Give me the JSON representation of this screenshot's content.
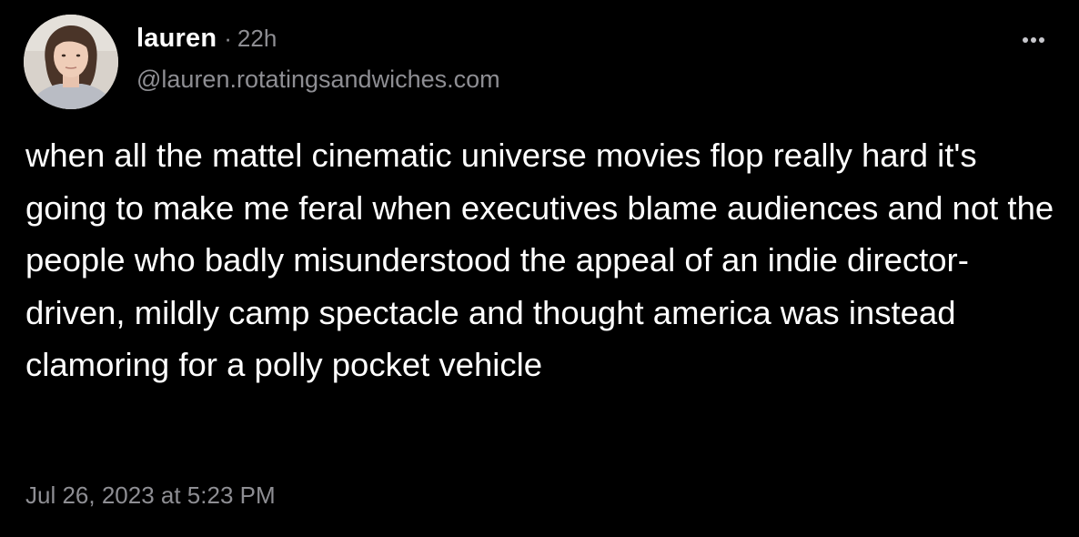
{
  "author": {
    "display_name": "lauren",
    "separator": "·",
    "relative_time": "22h",
    "handle": "@lauren.rotatingsandwiches.com"
  },
  "post": {
    "text": "when all the mattel cinematic universe movies flop really hard it's going to make me feral when executives blame audiences and not the people who badly misunderstood the appeal of an indie director-driven, mildly camp spectacle and thought america was instead clamoring for a polly pocket vehicle",
    "timestamp": "Jul 26, 2023 at 5:23 PM"
  },
  "actions": {
    "more_icon": "more-horizontal-icon"
  },
  "colors": {
    "background": "#000000",
    "primary_text": "#ffffff",
    "secondary_text": "#8e8e93"
  }
}
